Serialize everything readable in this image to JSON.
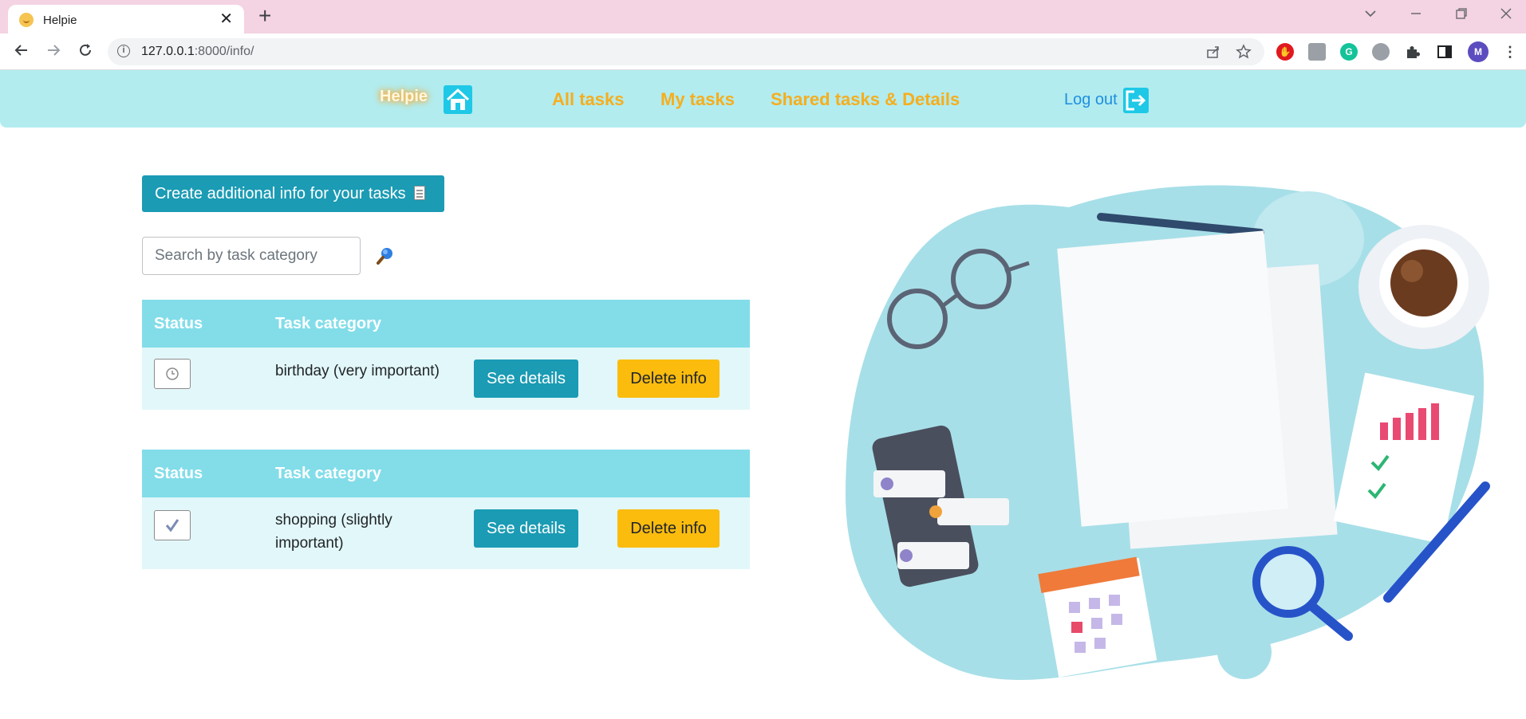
{
  "browser": {
    "tab_title": "Helpie",
    "tab_close": "✕",
    "new_tab": "+",
    "url_host": "127.0.0.1",
    "url_rest": ":8000/info/",
    "profile_initial": "M"
  },
  "header": {
    "brand": "Helpie",
    "nav": {
      "all_tasks": "All tasks",
      "my_tasks": "My tasks",
      "shared": "Shared tasks & Details"
    },
    "logout": "Log out"
  },
  "main": {
    "create_button": "Create additional info for your tasks",
    "search": {
      "placeholder": "Search by task category"
    },
    "tables": [
      {
        "headers": {
          "status": "Status",
          "category": "Task category"
        },
        "row": {
          "status": "pending",
          "category": "birthday (very important)",
          "details_label": "See details",
          "delete_label": "Delete info"
        }
      },
      {
        "headers": {
          "status": "Status",
          "category": "Task category"
        },
        "row": {
          "status": "done",
          "category": "shopping (slightly important)",
          "details_label": "See details",
          "delete_label": "Delete info"
        }
      }
    ]
  },
  "colors": {
    "header_bg": "#b2ecef",
    "nav_link": "#f6ae1d",
    "primary": "#1b9bb4",
    "warning": "#fbbc0e",
    "table_head": "#82dde9",
    "table_row": "#e2f7f9"
  }
}
